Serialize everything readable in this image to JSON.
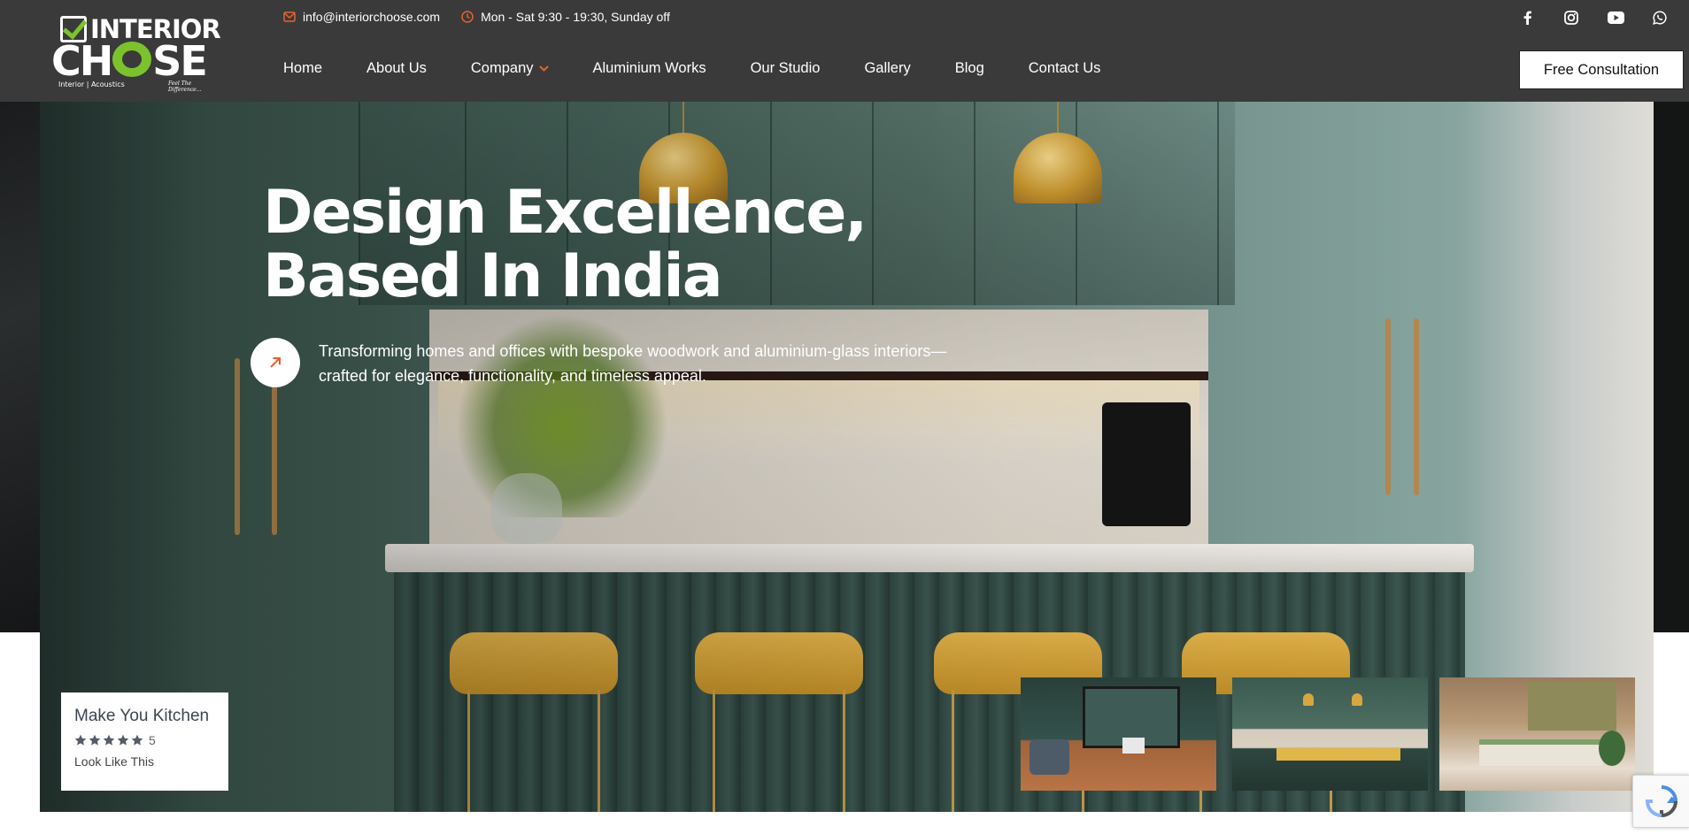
{
  "brand": {
    "logo_top": "INTERIOR",
    "logo_main_left": "CH",
    "logo_main_right": "SE",
    "logo_sub": "Interior | Acoustics",
    "logo_tag": "Feel The Difference..."
  },
  "topbar": {
    "email": "info@interiorchoose.com",
    "hours": "Mon - Sat 9:30 - 19:30, Sunday off"
  },
  "social_icons": [
    "facebook-icon",
    "instagram-icon",
    "youtube-icon",
    "whatsapp-icon"
  ],
  "nav": {
    "items": [
      {
        "label": "Home"
      },
      {
        "label": "About Us"
      },
      {
        "label": "Company"
      },
      {
        "label": "Aluminium Works"
      },
      {
        "label": "Our Studio"
      },
      {
        "label": "Gallery"
      },
      {
        "label": "Blog"
      },
      {
        "label": "Contact Us"
      }
    ],
    "cta": "Free Consultation"
  },
  "hero": {
    "title": "Design Excellence, Based In India",
    "description": "Transforming homes and offices with bespoke woodwork and aluminium-glass interiors—crafted for elegance, functionality, and timeless appeal."
  },
  "card": {
    "title": "Make You Kitchen",
    "rating": "5",
    "rating_value": 5,
    "subtitle": "Look Like This"
  },
  "thumbnails": [
    "home-office",
    "kitchen",
    "bedroom"
  ],
  "colors": {
    "header_bg": "#3a3a3a",
    "accent_orange": "#e8622c",
    "logo_green": "#7cc22d"
  }
}
